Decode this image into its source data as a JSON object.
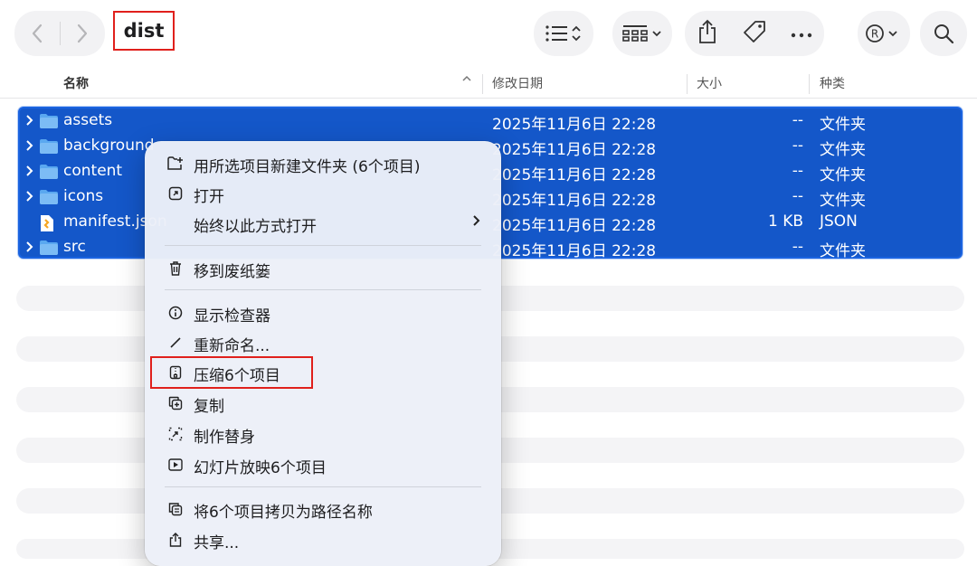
{
  "window": {
    "folder_title": "dist"
  },
  "toolbar": {
    "back_icon": "chevron-left-icon",
    "forward_icon": "chevron-right-icon",
    "view_icon": "list-view-icon",
    "group_icon": "grid-group-icon",
    "share_icon": "share-icon",
    "tag_icon": "tag-icon",
    "more_icon": "ellipsis-icon",
    "registered_icon": "registered-icon",
    "search_icon": "magnifier-icon"
  },
  "columns": {
    "name": "名称",
    "date": "修改日期",
    "size": "大小",
    "kind": "种类"
  },
  "files": [
    {
      "name": "assets",
      "date": "2025年11月6日 22:28",
      "size": "--",
      "kind": "文件夹",
      "type": "folder"
    },
    {
      "name": "background",
      "date": "2025年11月6日 22:28",
      "size": "--",
      "kind": "文件夹",
      "type": "folder"
    },
    {
      "name": "content",
      "date": "2025年11月6日 22:28",
      "size": "--",
      "kind": "文件夹",
      "type": "folder"
    },
    {
      "name": "icons",
      "date": "2025年11月6日 22:28",
      "size": "--",
      "kind": "文件夹",
      "type": "folder"
    },
    {
      "name": "manifest.json",
      "date": "2025年11月6日 22:28",
      "size": "1 KB",
      "kind": "JSON",
      "type": "file"
    },
    {
      "name": "src",
      "date": "2025年11月6日 22:28",
      "size": "--",
      "kind": "文件夹",
      "type": "folder"
    }
  ],
  "context_menu": {
    "new_folder_with_selection": "用所选项目新建文件夹 (6个项目)",
    "open": "打开",
    "always_open_with": "始终以此方式打开",
    "move_to_trash": "移到废纸篓",
    "get_info": "显示检查器",
    "rename": "重新命名...",
    "compress": "压缩6个项目",
    "duplicate": "复制",
    "make_alias": "制作替身",
    "slideshow": "幻灯片放映6个项目",
    "copy_path": "将6个项目拷贝为路径名称",
    "share": "共享..."
  },
  "colors": {
    "selection": "#1457c9",
    "highlight_box": "#e0201c",
    "folder": "#5aa8f0"
  }
}
